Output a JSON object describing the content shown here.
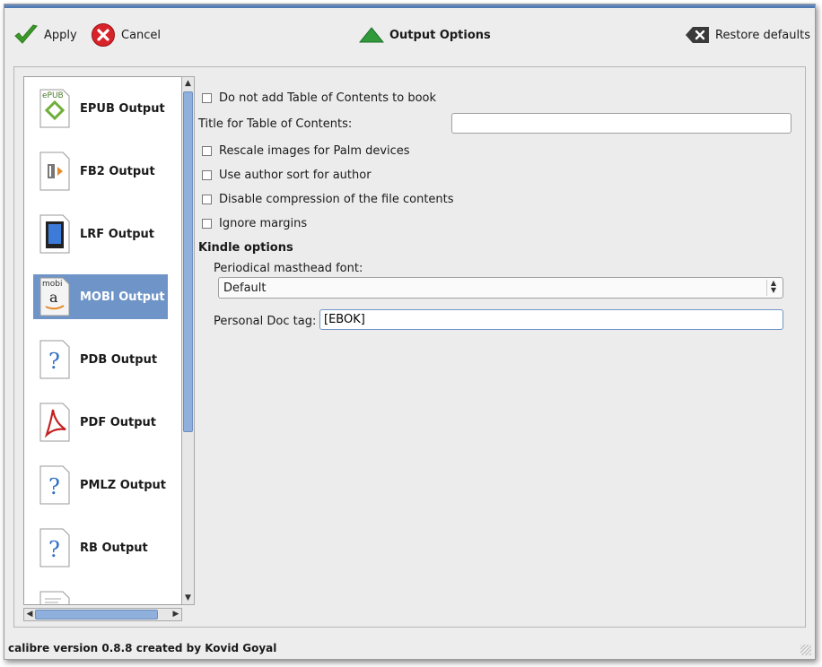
{
  "toolbar": {
    "apply_label": "Apply",
    "cancel_label": "Cancel",
    "title_label": "Output Options",
    "restore_label": "Restore defaults"
  },
  "sidebar": {
    "items": [
      {
        "label": "EPUB Output",
        "icon": "epub-icon",
        "badge": "ePUB"
      },
      {
        "label": "FB2 Output",
        "icon": "fb2-icon"
      },
      {
        "label": "LRF Output",
        "icon": "lrf-icon"
      },
      {
        "label": "MOBI Output",
        "icon": "mobi-icon",
        "badge": "mobi",
        "selected": true
      },
      {
        "label": "PDB Output",
        "icon": "question-icon"
      },
      {
        "label": "PDF Output",
        "icon": "pdf-icon"
      },
      {
        "label": "PMLZ Output",
        "icon": "question-icon"
      },
      {
        "label": "RB Output",
        "icon": "question-icon"
      }
    ]
  },
  "options": {
    "no_toc_label": "Do not add Table of Contents to book",
    "toc_title_label": "Title for Table of Contents:",
    "toc_title_value": "",
    "rescale_label": "Rescale images for Palm devices",
    "author_sort_label": "Use author sort for author",
    "disable_compression_label": "Disable compression of the file contents",
    "ignore_margins_label": "Ignore margins",
    "kindle_heading": "Kindle options",
    "masthead_label": "Periodical masthead font:",
    "masthead_value": "Default",
    "doc_tag_label": "Personal Doc tag:",
    "doc_tag_value": "[EBOK]"
  },
  "status": {
    "text": "calibre version 0.8.8 created by Kovid Goyal"
  },
  "colors": {
    "selection": "#6f95c8",
    "scroll_thumb": "#8fb0dd",
    "apply_check": "#3b9a2a",
    "cancel_red": "#d8232a"
  }
}
